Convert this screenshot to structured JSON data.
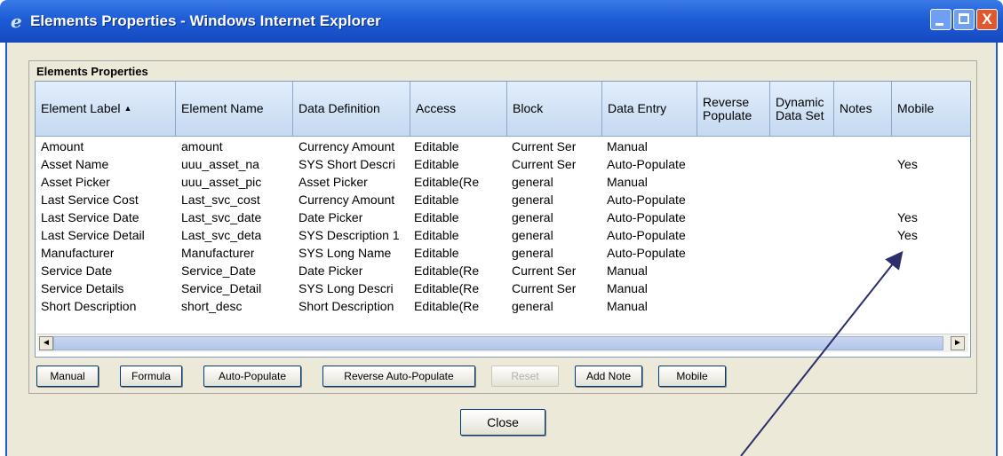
{
  "window": {
    "title": "Elements Properties - Windows Internet Explorer",
    "icon": "ie-icon",
    "controls": {
      "close_glyph": "X"
    }
  },
  "group": {
    "title": "Elements Properties"
  },
  "table": {
    "columns": [
      {
        "label": "Element Label",
        "sorted": "ascending",
        "sort_glyph": "▲"
      },
      {
        "label": "Element Name"
      },
      {
        "label": "Data Definition"
      },
      {
        "label": "Access"
      },
      {
        "label": "Block"
      },
      {
        "label": "Data Entry"
      },
      {
        "label": "Reverse Populate"
      },
      {
        "label": "Dynamic Data Set"
      },
      {
        "label": "Notes"
      },
      {
        "label": "Mobile"
      }
    ],
    "rows": [
      [
        "Amount",
        "amount",
        "Currency Amount",
        "Editable",
        "Current Ser",
        "Manual",
        "",
        "",
        "",
        ""
      ],
      [
        "Asset Name",
        "uuu_asset_na",
        "SYS Short Descri",
        "Editable",
        "Current Ser",
        "Auto-Populate",
        "",
        "",
        "",
        "Yes"
      ],
      [
        "Asset Picker",
        "uuu_asset_pic",
        "Asset Picker",
        "Editable(Re",
        "general",
        "Manual",
        "",
        "",
        "",
        ""
      ],
      [
        "Last Service Cost",
        "Last_svc_cost",
        "Currency Amount",
        "Editable",
        "general",
        "Auto-Populate",
        "",
        "",
        "",
        ""
      ],
      [
        "Last Service Date",
        "Last_svc_date",
        "Date Picker",
        "Editable",
        "general",
        "Auto-Populate",
        "",
        "",
        "",
        "Yes"
      ],
      [
        "Last Service Detail",
        "Last_svc_deta",
        "SYS Description 1",
        "Editable",
        "general",
        "Auto-Populate",
        "",
        "",
        "",
        "Yes"
      ],
      [
        "Manufacturer",
        "Manufacturer",
        "SYS Long Name",
        "Editable",
        "general",
        "Auto-Populate",
        "",
        "",
        "",
        ""
      ],
      [
        "Service Date",
        "Service_Date",
        "Date Picker",
        "Editable(Re",
        "Current Ser",
        "Manual",
        "",
        "",
        "",
        ""
      ],
      [
        "Service Details",
        "Service_Detail",
        "SYS Long Descri",
        "Editable(Re",
        "Current Ser",
        "Manual",
        "",
        "",
        "",
        ""
      ],
      [
        "Short Description",
        "short_desc",
        "Short Description",
        "Editable(Re",
        "general",
        "Manual",
        "",
        "",
        "",
        ""
      ]
    ]
  },
  "scrollbar": {
    "left_glyph": "◄",
    "right_glyph": "►"
  },
  "buttons": [
    {
      "label": "Manual",
      "enabled": true
    },
    {
      "label": "Formula",
      "enabled": true
    },
    {
      "label": "Auto-Populate",
      "enabled": true
    },
    {
      "label": "Reverse Auto-Populate",
      "enabled": true
    },
    {
      "label": "Reset",
      "enabled": false
    },
    {
      "label": "Add Note",
      "enabled": true
    },
    {
      "label": "Mobile",
      "enabled": true
    }
  ],
  "close_button": {
    "label": "Close"
  },
  "colors": {
    "titlebar": "#1d5cd6",
    "dialog_bg": "#ece9d8",
    "header_bg": "#c5d9f1",
    "close_control": "#e0582e"
  }
}
